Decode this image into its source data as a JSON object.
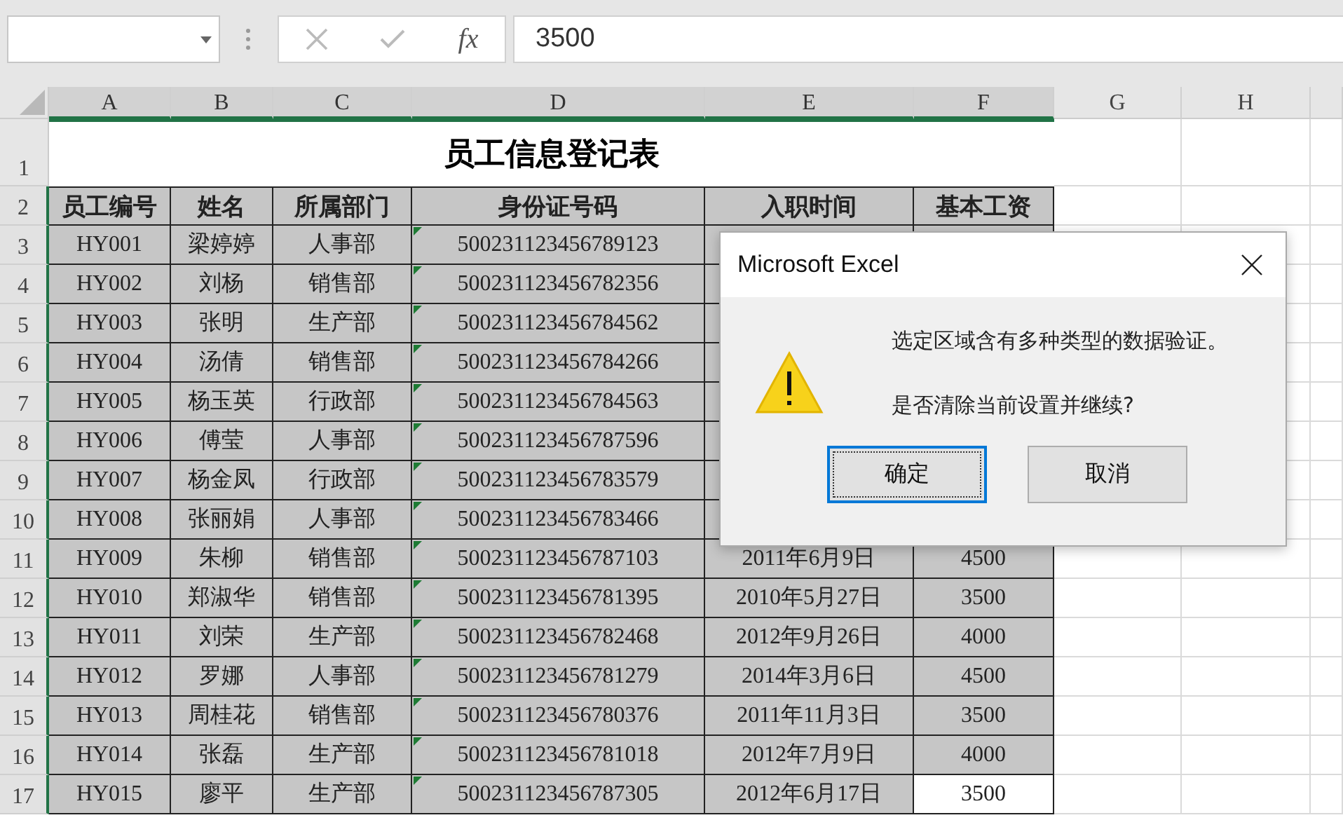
{
  "formula_bar": {
    "fx_label": "fx",
    "value": "3500"
  },
  "sheet": {
    "columns": [
      {
        "label": "A",
        "selected": true
      },
      {
        "label": "B",
        "selected": true
      },
      {
        "label": "C",
        "selected": true
      },
      {
        "label": "D",
        "selected": true
      },
      {
        "label": "E",
        "selected": true
      },
      {
        "label": "F",
        "selected": true
      },
      {
        "label": "G",
        "selected": false
      },
      {
        "label": "H",
        "selected": false
      }
    ],
    "title_row": {
      "number": "1",
      "title": "员工信息登记表"
    },
    "rows": [
      {
        "number": "2",
        "kind": "header",
        "cells": [
          "员工编号",
          "姓名",
          "所属部门",
          "身份证号码",
          "入职时间",
          "基本工资"
        ]
      },
      {
        "number": "3",
        "kind": "data",
        "id_flag": true,
        "active": false,
        "cells": [
          "HY001",
          "梁婷婷",
          "人事部",
          "500231123456789123"
        ]
      },
      {
        "number": "4",
        "kind": "data",
        "id_flag": true,
        "active": false,
        "cells": [
          "HY002",
          "刘杨",
          "销售部",
          "500231123456782356"
        ]
      },
      {
        "number": "5",
        "kind": "data",
        "id_flag": true,
        "active": false,
        "cells": [
          "HY003",
          "张明",
          "生产部",
          "500231123456784562"
        ]
      },
      {
        "number": "6",
        "kind": "data",
        "id_flag": true,
        "active": false,
        "cells": [
          "HY004",
          "汤倩",
          "销售部",
          "500231123456784266"
        ]
      },
      {
        "number": "7",
        "kind": "data",
        "id_flag": true,
        "active": false,
        "cells": [
          "HY005",
          "杨玉英",
          "行政部",
          "500231123456784563"
        ]
      },
      {
        "number": "8",
        "kind": "data",
        "id_flag": true,
        "active": false,
        "cells": [
          "HY006",
          "傅莹",
          "人事部",
          "500231123456787596"
        ]
      },
      {
        "number": "9",
        "kind": "data",
        "id_flag": true,
        "active": false,
        "cells": [
          "HY007",
          "杨金凤",
          "行政部",
          "500231123456783579"
        ]
      },
      {
        "number": "10",
        "kind": "data",
        "id_flag": true,
        "active": false,
        "cells": [
          "HY008",
          "张丽娟",
          "人事部",
          "500231123456783466"
        ]
      },
      {
        "number": "11",
        "kind": "data",
        "id_flag": true,
        "active": false,
        "cells": [
          "HY009",
          "朱柳",
          "销售部",
          "500231123456787103",
          "2011年6月9日",
          "4500"
        ]
      },
      {
        "number": "12",
        "kind": "data",
        "id_flag": true,
        "active": false,
        "cells": [
          "HY010",
          "郑淑华",
          "销售部",
          "500231123456781395",
          "2010年5月27日",
          "3500"
        ]
      },
      {
        "number": "13",
        "kind": "data",
        "id_flag": true,
        "active": false,
        "cells": [
          "HY011",
          "刘荣",
          "生产部",
          "500231123456782468",
          "2012年9月26日",
          "4000"
        ]
      },
      {
        "number": "14",
        "kind": "data",
        "id_flag": true,
        "active": false,
        "cells": [
          "HY012",
          "罗娜",
          "人事部",
          "500231123456781279",
          "2014年3月6日",
          "4500"
        ]
      },
      {
        "number": "15",
        "kind": "data",
        "id_flag": true,
        "active": false,
        "cells": [
          "HY013",
          "周桂花",
          "销售部",
          "500231123456780376",
          "2011年11月3日",
          "3500"
        ]
      },
      {
        "number": "16",
        "kind": "data",
        "id_flag": true,
        "active": false,
        "cells": [
          "HY014",
          "张磊",
          "生产部",
          "500231123456781018",
          "2012年7月9日",
          "4000"
        ]
      },
      {
        "number": "17",
        "kind": "data",
        "id_flag": true,
        "active": true,
        "cells": [
          "HY015",
          "廖平",
          "生产部",
          "500231123456787305",
          "2012年6月17日",
          "3500"
        ]
      }
    ]
  },
  "dialog": {
    "title": "Microsoft Excel",
    "lines": [
      "选定区域含有多种类型的数据验证。",
      "是否清除当前设置并继续?"
    ],
    "buttons": [
      {
        "label": "确定",
        "selected": true
      },
      {
        "label": "取消",
        "selected": false
      }
    ]
  }
}
